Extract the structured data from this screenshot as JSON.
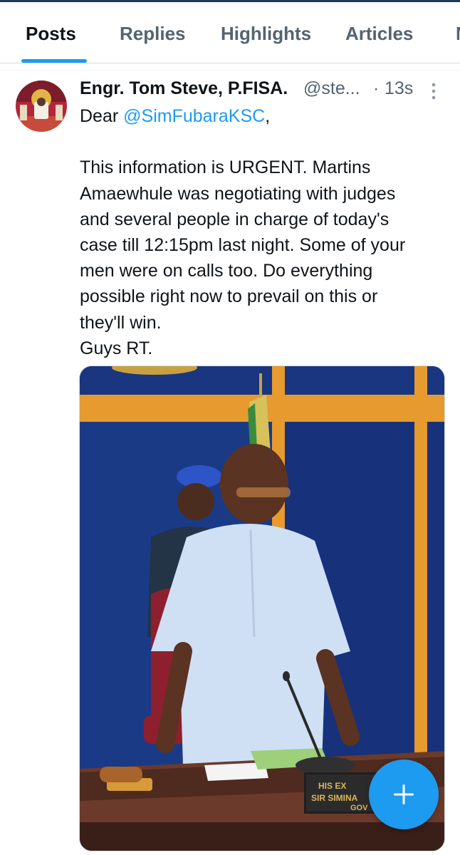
{
  "tabs": [
    {
      "label": "Posts",
      "active": true
    },
    {
      "label": "Replies",
      "active": false
    },
    {
      "label": "Highlights",
      "active": false
    },
    {
      "label": "Articles",
      "active": false
    },
    {
      "label": "M",
      "active": false
    }
  ],
  "post": {
    "display_name": "Engr. Tom Steve, P.FISA.",
    "handle": "@ste...",
    "separator": "·",
    "time": "13s",
    "greeting_prefix": "Dear ",
    "mention": "@SimFubaraKSC",
    "greeting_suffix": ",",
    "body_lines": [
      "This information is URGENT. Martins",
      "Amaewhule was negotiating with judges",
      "and several people in charge of today's",
      "case till 12:15pm last night. Some of your",
      "men were on calls too. Do everything",
      "possible right now to prevail on this or",
      "they'll win.",
      "Guys RT."
    ],
    "media": {
      "nameplate_line1": "HIS EX",
      "nameplate_line2": "SIR SIMINA",
      "nameplate_line3": "GOV"
    }
  },
  "icons": {
    "more": "more-vertical-icon",
    "fab": "compose-plus-icon"
  },
  "colors": {
    "accent": "#1d9bf0",
    "text_primary": "#0f1419",
    "text_secondary": "#536471"
  }
}
